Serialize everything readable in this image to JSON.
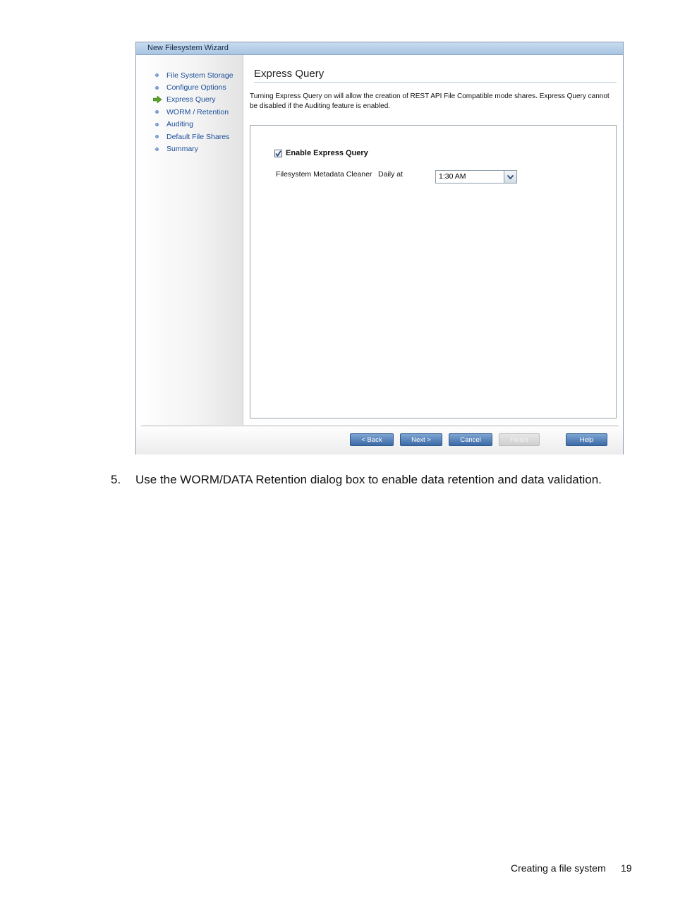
{
  "wizard": {
    "title": "New Filesystem Wizard",
    "steps": [
      {
        "label": "File System Storage",
        "current": false
      },
      {
        "label": "Configure Options",
        "current": false
      },
      {
        "label": "Express Query",
        "current": true
      },
      {
        "label": "WORM / Retention",
        "current": false
      },
      {
        "label": "Auditing",
        "current": false
      },
      {
        "label": "Default File Shares",
        "current": false
      },
      {
        "label": "Summary",
        "current": false
      }
    ],
    "heading": "Express Query",
    "description": "Turning Express Query on will allow the creation of REST API File Compatible mode shares. Express Query cannot be disabled if the Auditing feature is enabled.",
    "enable_checkbox": {
      "label": "Enable Express Query",
      "checked": true
    },
    "metadata_cleaner": {
      "label": "Filesystem Metadata Cleaner",
      "schedule_label": "Daily at",
      "time_value": "1:30 AM"
    },
    "buttons": {
      "back": "< Back",
      "next": "Next >",
      "cancel": "Cancel",
      "finish": "Finish",
      "help": "Help"
    }
  },
  "document": {
    "step_number": "5.",
    "step_text": "Use the WORM/DATA Retention dialog box to enable data retention and data validation.",
    "footer_section": "Creating a file system",
    "page_number": "19"
  }
}
